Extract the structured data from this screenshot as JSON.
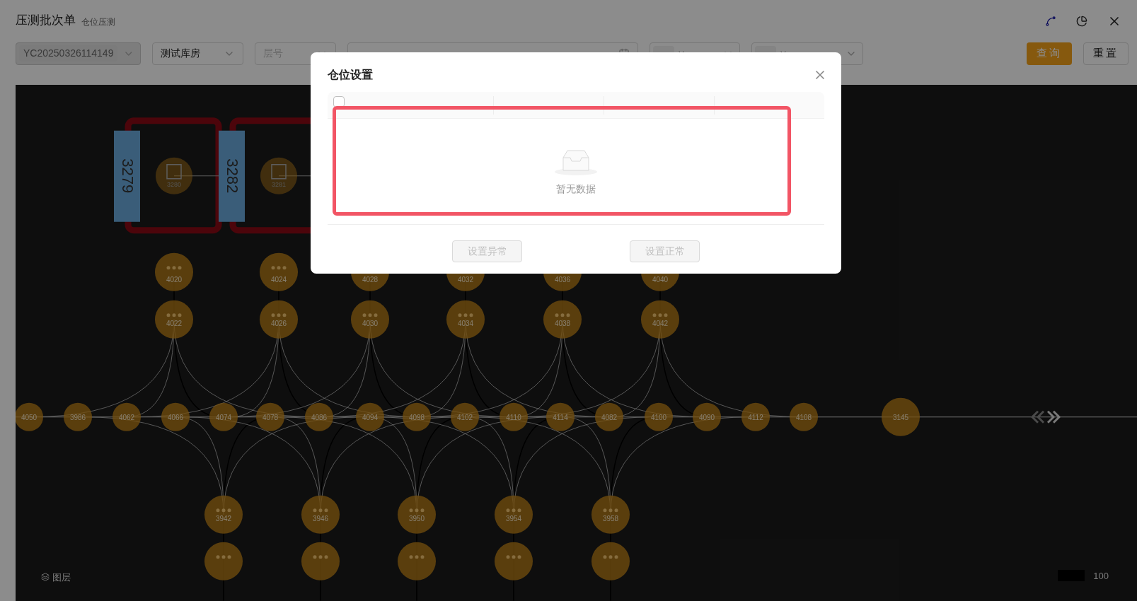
{
  "header": {
    "title": "压测批次单",
    "subtitle": "仓位压测"
  },
  "filters": [
    {
      "kind": "tag-select",
      "tag": "YC20250326114149",
      "disabled": true
    },
    {
      "kind": "select",
      "value": "测试库房",
      "disabled": false
    },
    {
      "kind": "select",
      "placeholder": "层号",
      "disabled": false
    },
    {
      "kind": "date-range",
      "disabled": false
    },
    {
      "kind": "tag-select",
      "disabled": false
    },
    {
      "kind": "tag-select",
      "disabled": false
    }
  ],
  "actions": [
    {
      "label": "查询",
      "primary": true
    },
    {
      "label": "重置",
      "primary": false
    }
  ],
  "map": {
    "racks": [
      {
        "label": "3279",
        "node": "3280"
      },
      {
        "label": "3282",
        "node": "3281"
      }
    ],
    "row_1": [
      "4020",
      "4024",
      "4028",
      "4032",
      "4036",
      "4040"
    ],
    "row_2": [
      "4022",
      "4026",
      "4030",
      "4034",
      "4038",
      "4042"
    ],
    "row_3": [
      "4050",
      "3986",
      "4062",
      "4066",
      "4074",
      "4078",
      "4086",
      "4094",
      "4098",
      "4102",
      "4110",
      "4114",
      "4082",
      "4100",
      "4090",
      "4112",
      "4108",
      "3145"
    ],
    "row_4": [
      "3942",
      "3946",
      "3950",
      "3954",
      "3958"
    ]
  },
  "layers": {
    "label": "图层"
  },
  "legend": {
    "label": "100"
  },
  "modal": {
    "title": "仓位设置",
    "select_all": false,
    "empty_text": "暂无数据",
    "buttons": [
      {
        "label": "设置异常",
        "disabled": true
      },
      {
        "label": "设置正常",
        "disabled": true
      }
    ]
  }
}
